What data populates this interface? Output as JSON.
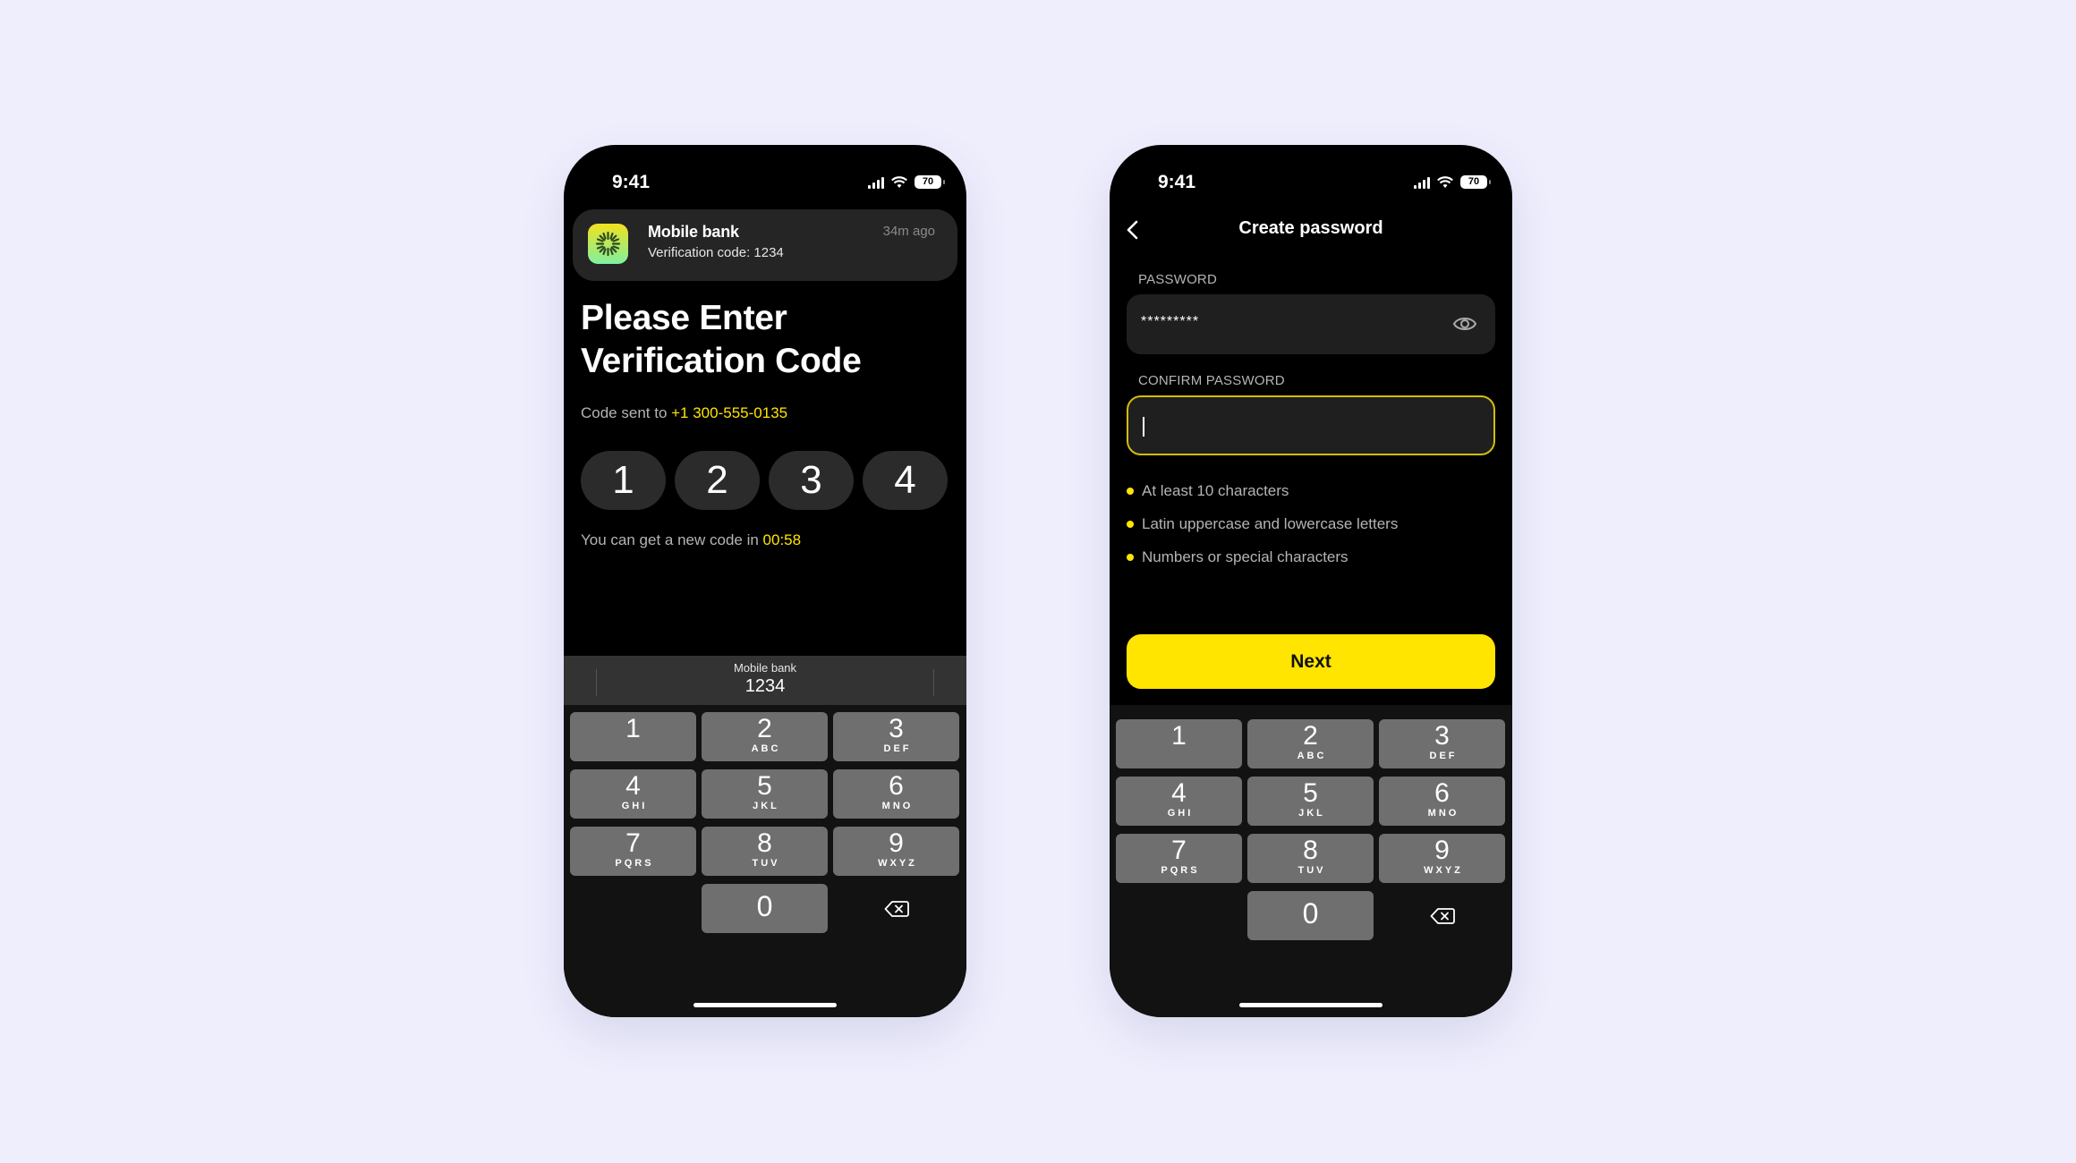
{
  "screens": {
    "verification": {
      "status_bar": {
        "time": "9:41",
        "battery": "70"
      },
      "notification": {
        "app_name": "Mobile bank",
        "message": "Verification code: 1234",
        "time": "34m ago",
        "icon": "app-logo-icon"
      },
      "heading_line1": "Please Enter",
      "heading_line2": "Verification Code",
      "code_sent_prefix": "Code sent to ",
      "phone_number": "+1 300-555-0135",
      "code_digits": [
        "1",
        "2",
        "3",
        "4"
      ],
      "resend_prefix": "You can get a new code in ",
      "resend_timer": "00:58",
      "autofill": {
        "source": "Mobile bank",
        "code": "1234"
      }
    },
    "create_password": {
      "status_bar": {
        "time": "9:41",
        "battery": "70"
      },
      "title": "Create password",
      "back_icon": "chevron-left-icon",
      "password": {
        "label": "PASSWORD",
        "value": "*********",
        "toggle_icon": "eye-icon"
      },
      "confirm_password": {
        "label": "CONFIRM PASSWORD",
        "value": ""
      },
      "requirements": [
        "At least 10 characters",
        "Latin uppercase and lowercase letters",
        "Numbers or special characters"
      ],
      "next_label": "Next"
    }
  },
  "keypad": {
    "keys": [
      {
        "num": "1",
        "letters": ""
      },
      {
        "num": "2",
        "letters": "ABC"
      },
      {
        "num": "3",
        "letters": "DEF"
      },
      {
        "num": "4",
        "letters": "GHI"
      },
      {
        "num": "5",
        "letters": "JKL"
      },
      {
        "num": "6",
        "letters": "MNO"
      },
      {
        "num": "7",
        "letters": "PQRS"
      },
      {
        "num": "8",
        "letters": "TUV"
      },
      {
        "num": "9",
        "letters": "WXYZ"
      },
      {
        "num": "0",
        "letters": ""
      }
    ],
    "delete_icon": "backspace-icon"
  },
  "colors": {
    "accent": "#ffe500",
    "background": "#eeeefd",
    "screen": "#000000",
    "key": "#6f6f6f",
    "field": "#1f1f1f"
  }
}
